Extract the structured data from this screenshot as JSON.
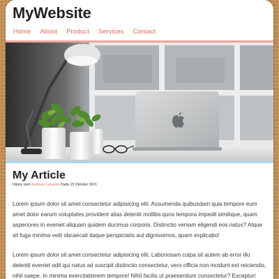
{
  "site": {
    "title": "MyWebsite"
  },
  "nav": {
    "items": [
      {
        "label": "Home"
      },
      {
        "label": "About"
      },
      {
        "label": "Product"
      },
      {
        "label": "Services"
      },
      {
        "label": "Contact"
      }
    ]
  },
  "colors": {
    "link": "#e26b5f",
    "nav_divider": "#f0a49a",
    "hero_divider": "#a9d5ee",
    "page_background": "#c6935c"
  },
  "hero": {
    "icon": "apple-logo-icon"
  },
  "article": {
    "title": "My Article",
    "byline_prefix": "Ditulis oleh",
    "author": "Andrean Lunanso",
    "byline_middle": "Pada",
    "date": "15 Oktober 2021",
    "paragraphs": [
      "Lorem ipsum dolor sit amet consectetur adipisicing elit. Assumenda quibusdam quia tempore eum amet dolor earum voluptates provident alias deleniti mollitia quos tempora impedit similique, quam asperiores in eveniet aliquam quidem ducimus corporis. Distinctio veniam eligendi eos natus? Atque sit fuga minima velit obcaecati itaque perspiciatis aut dignissimos, quam explicabo!",
      "Lorem ipsum dolor sit amet consectetur adipisicing elit. Laboriosam culpa sit autem ab error illo deleniti eveniet odit qui natus ad suscipit distinctio consectetur, vero officia non incidunt est reiciendis, nihil saepe. In minima exercitationem tempore! Nihil facilis ut praesentium consectetur? Excepturi atque provident eius"
    ]
  }
}
